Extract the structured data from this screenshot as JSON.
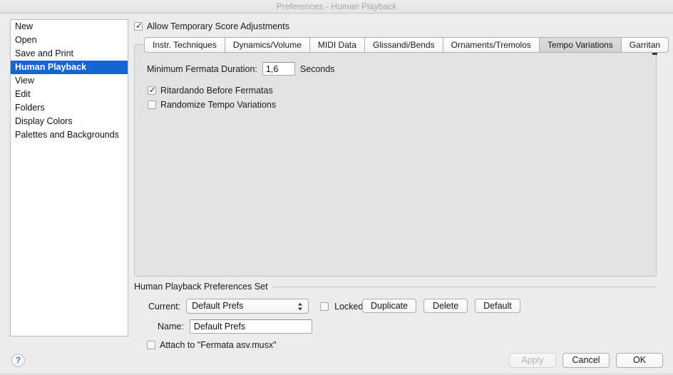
{
  "window": {
    "title": "Preferences - Human Playback"
  },
  "sidebar": {
    "items": [
      {
        "label": "New",
        "selected": false
      },
      {
        "label": "Open",
        "selected": false
      },
      {
        "label": "Save and Print",
        "selected": false
      },
      {
        "label": "Human Playback",
        "selected": true
      },
      {
        "label": "View",
        "selected": false
      },
      {
        "label": "Edit",
        "selected": false
      },
      {
        "label": "Folders",
        "selected": false
      },
      {
        "label": "Display Colors",
        "selected": false
      },
      {
        "label": "Palettes and Backgrounds",
        "selected": false
      }
    ]
  },
  "main": {
    "allow_temp_label": "Allow Temporary Score Adjustments",
    "allow_temp_checked": true,
    "tabs": [
      {
        "label": "Instr. Techniques",
        "active": false
      },
      {
        "label": "Dynamics/Volume",
        "active": false
      },
      {
        "label": "MIDI Data",
        "active": false
      },
      {
        "label": "Glissandi/Bends",
        "active": false
      },
      {
        "label": "Ornaments/Tremolos",
        "active": false
      },
      {
        "label": "Tempo Variations",
        "active": true
      },
      {
        "label": "Garritan",
        "active": false
      }
    ],
    "fermata_label": "Minimum Fermata Duration:",
    "fermata_value": "1,6",
    "fermata_unit": "Seconds",
    "ritardando_label": "Ritardando Before Fermatas",
    "ritardando_checked": true,
    "randomize_label": "Randomize Tempo Variations",
    "randomize_checked": false
  },
  "prefs_set": {
    "group_title": "Human Playback Preferences Set",
    "current_label": "Current:",
    "current_value": "Default Prefs",
    "locked_label": "Locked",
    "locked_checked": false,
    "duplicate_label": "Duplicate",
    "delete_label": "Delete",
    "default_label": "Default",
    "name_label": "Name:",
    "name_value": "Default Prefs",
    "attach_label": "Attach to \"Fermata asv.musx\"",
    "attach_checked": false
  },
  "footer": {
    "help_glyph": "?",
    "apply_label": "Apply",
    "apply_disabled": true,
    "cancel_label": "Cancel",
    "ok_label": "OK"
  },
  "colors": {
    "selection_blue": "#1464d4",
    "help_blue": "#3e7fd0",
    "window_bg": "#ececec",
    "panel_bg": "#e3e3e3"
  }
}
